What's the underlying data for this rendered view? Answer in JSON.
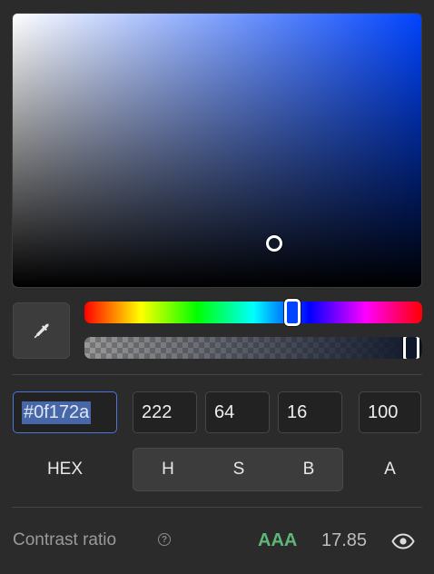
{
  "color": {
    "hex": "#0f172a",
    "hue": 222,
    "saturation": 64,
    "brightness": 16,
    "alpha": 100,
    "hue_swatch": "#0044ff",
    "alpha_swatch": "#0f172a"
  },
  "inputs": {
    "hex_value": "#0f172a",
    "h_value": "222",
    "s_value": "64",
    "b_value": "16",
    "a_value": "100"
  },
  "modes": {
    "hex_label": "HEX",
    "h_label": "H",
    "s_label": "S",
    "b_label": "B",
    "a_label": "A"
  },
  "contrast": {
    "label": "Contrast ratio",
    "help_glyph": "?",
    "rating": "AAA",
    "rating_color": "#5fb677",
    "value": "17.85"
  },
  "icons": {
    "eyedropper": "eyedropper-icon",
    "help": "help-icon",
    "preview": "eye-icon"
  }
}
